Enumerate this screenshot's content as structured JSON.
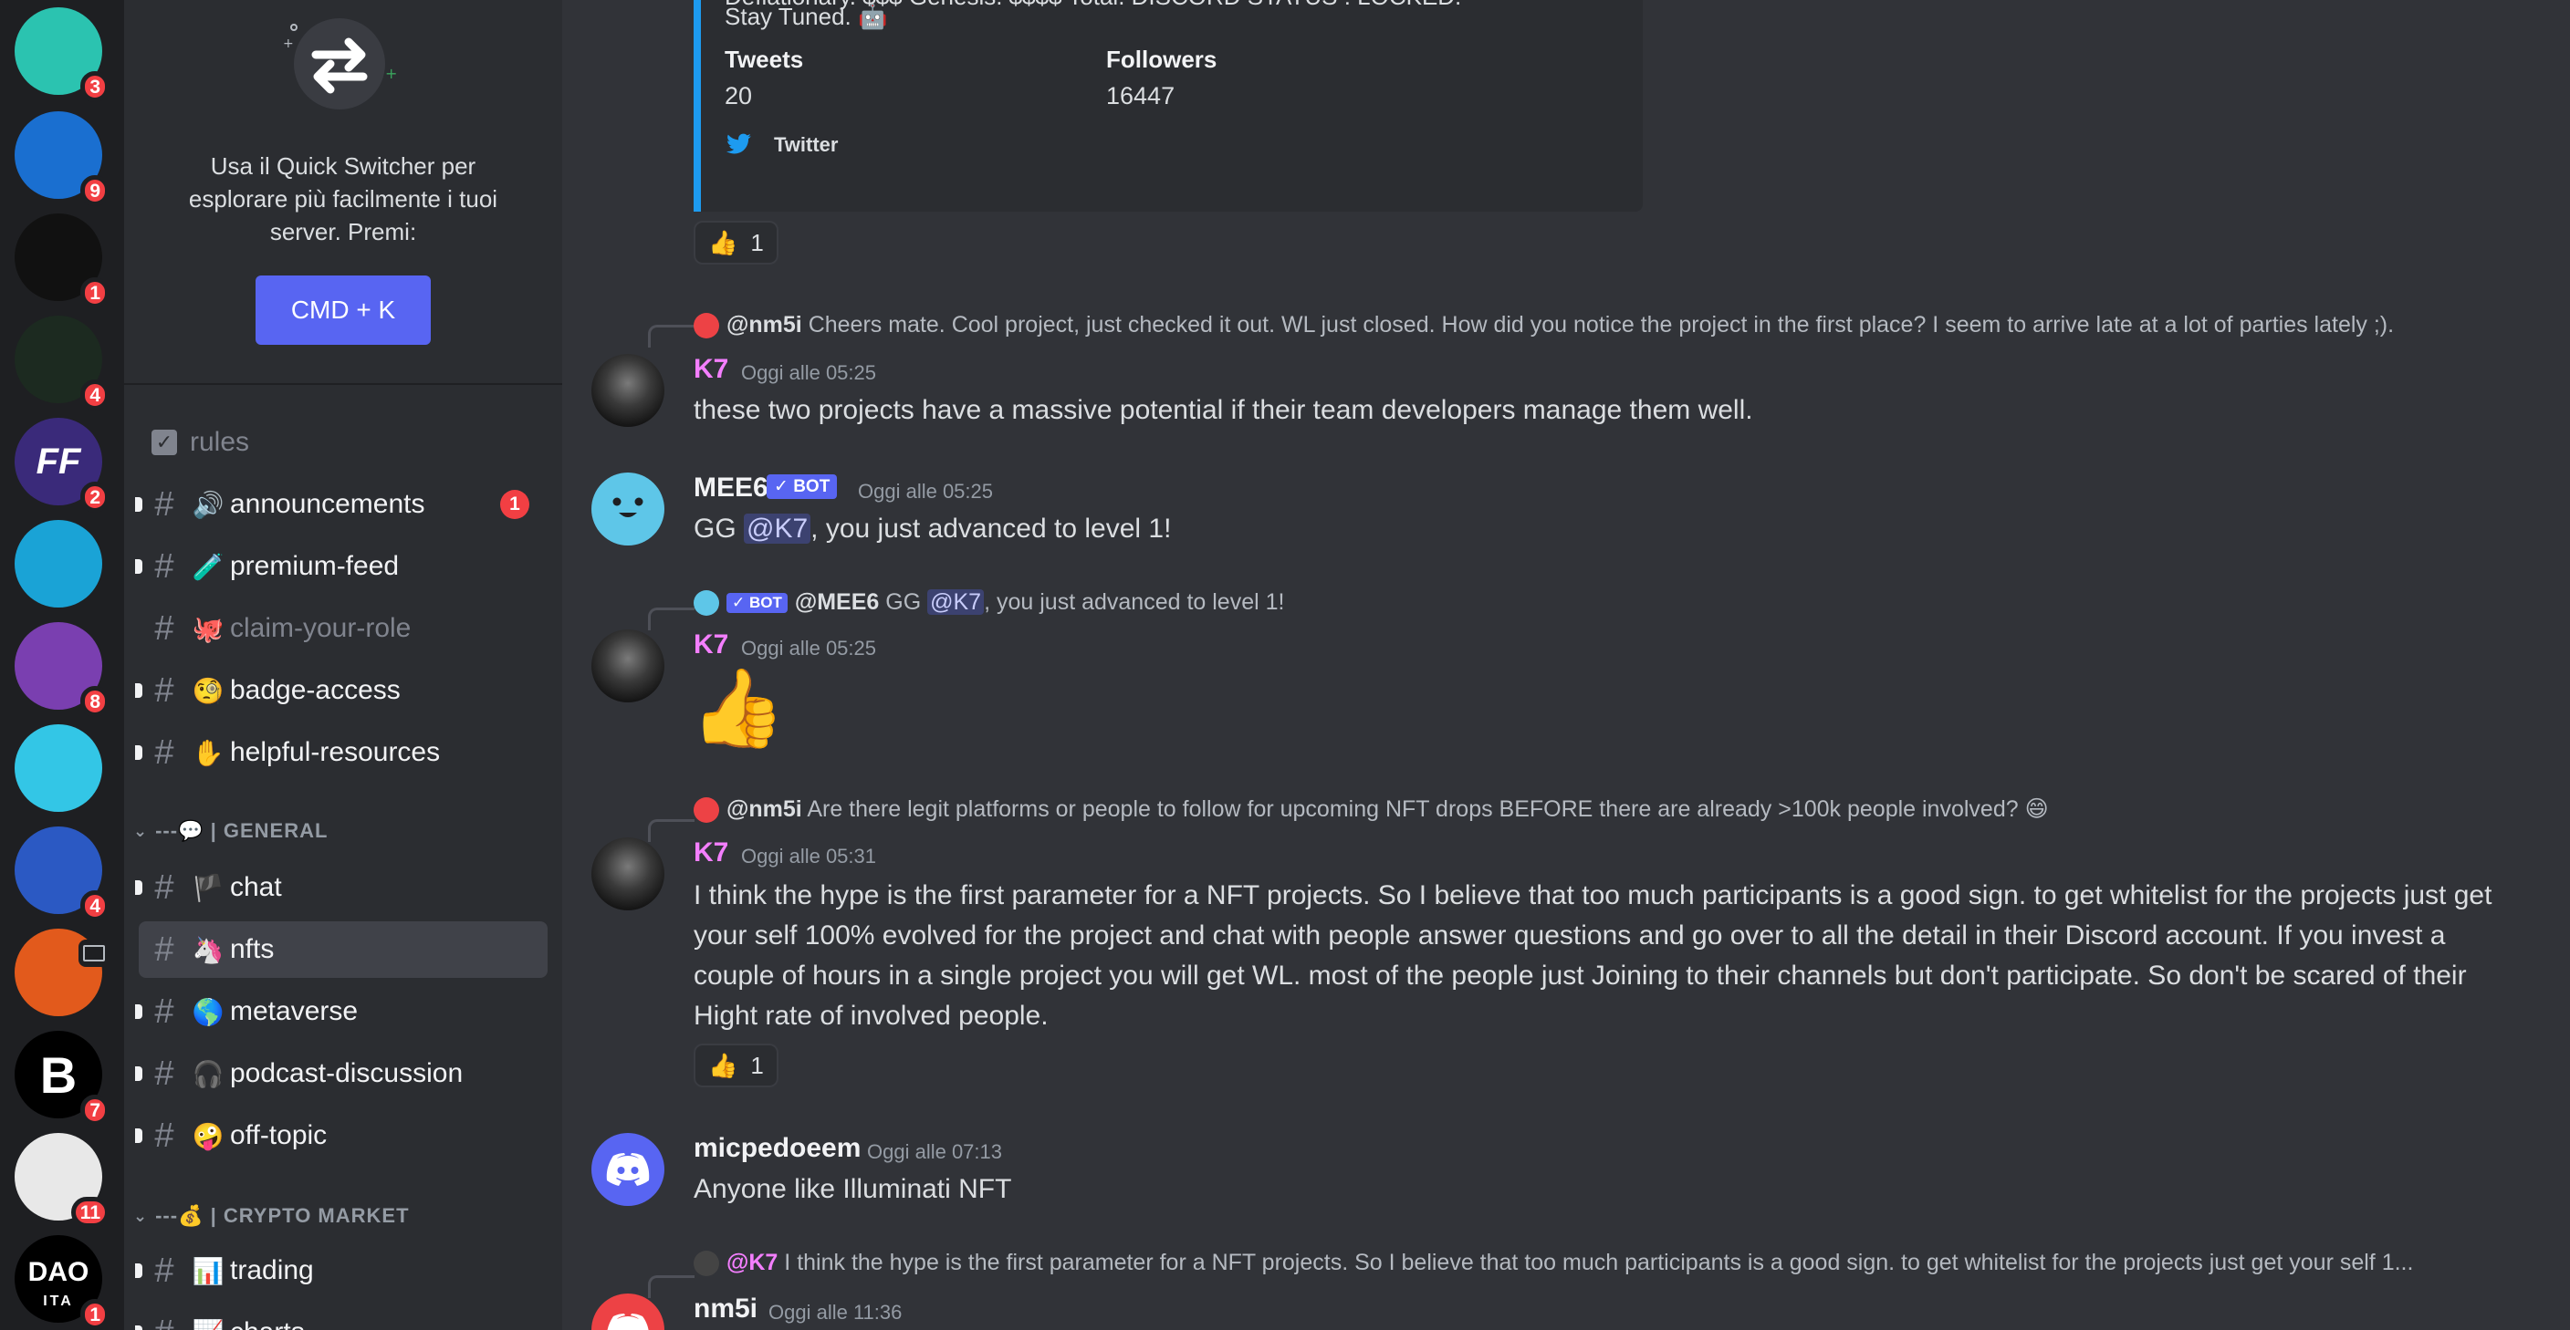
{
  "servers": [
    {
      "name": "alien-server",
      "badge": "3",
      "bg": "#2bc3b0"
    },
    {
      "name": "rocket-server",
      "badge": "9",
      "bg": "#1a6fd0"
    },
    {
      "name": "hourglass-server",
      "badge": "1",
      "bg": "#111111"
    },
    {
      "name": "green-shape-server",
      "badge": "4",
      "bg": "#1c2a20"
    },
    {
      "name": "ff-server",
      "label": "FF",
      "badge": "2",
      "bg": "#3a2a7a"
    },
    {
      "name": "swirl-server",
      "badge": "",
      "bg": "#1aa3d6"
    },
    {
      "name": "hat-server",
      "badge": "8",
      "bg": "#7a3fb0"
    },
    {
      "name": "wave-server",
      "badge": "",
      "bg": "#33c6e6"
    },
    {
      "name": "blue-rocket-server",
      "badge": "4",
      "bg": "#2b59c3"
    },
    {
      "name": "pizza-server",
      "badge": "",
      "bg": "#e25a1c"
    },
    {
      "name": "b-server",
      "label": "B",
      "badge": "7",
      "bg": "#000000"
    },
    {
      "name": "avatar-server",
      "badge": "11",
      "bg": "#e8e8e8"
    },
    {
      "name": "dao-server",
      "label": "DAO",
      "sublabel": "ITA",
      "badge": "1",
      "bg": "#000000"
    }
  ],
  "switcher": {
    "text": "Usa il Quick Switcher per esplorare più facilmente i tuoi server. Premi:",
    "button": "CMD + K"
  },
  "channels": {
    "rules": "rules",
    "announcements": {
      "name": "announcements",
      "emoji": "🔊",
      "unread": "1"
    },
    "premium": {
      "name": "premium-feed",
      "emoji": "🧪"
    },
    "claim": {
      "name": "claim-your-role",
      "emoji": "🐙"
    },
    "badge": {
      "name": "badge-access",
      "emoji": "🧐"
    },
    "helpful": {
      "name": "helpful-resources",
      "emoji": "✋"
    },
    "general_category": "---💬 | GENERAL",
    "chat": {
      "name": "chat",
      "emoji": "🏴"
    },
    "nfts": {
      "name": "nfts",
      "emoji": "🦄"
    },
    "metaverse": {
      "name": "metaverse",
      "emoji": "🌎"
    },
    "podcast": {
      "name": "podcast-discussion",
      "emoji": "🎧"
    },
    "offtopic": {
      "name": "off-topic",
      "emoji": "🤪"
    },
    "crypto_category": "---💰 | CRYPTO MARKET",
    "trading": {
      "name": "trading",
      "emoji": "📊"
    },
    "charts": {
      "name": "charts",
      "emoji": "📈"
    }
  },
  "embed": {
    "line1": "Deflationary. $$$ Genesis. $$$$ Total. DISCORD STATUS : LOCKED.",
    "line2": "Stay Tuned. 🤖",
    "tweets_label": "Tweets",
    "tweets_value": "20",
    "followers_label": "Followers",
    "followers_value": "16447",
    "footer": "Twitter"
  },
  "reaction1": {
    "emoji": "👍",
    "count": "1"
  },
  "messages": {
    "m1": {
      "reply_name": "@nm5i",
      "reply_text": "Cheers mate. Cool project, just checked it out. WL just closed. How did you notice the project in the first place? I seem to arrive late at a lot of parties lately ;).",
      "author": "K7",
      "author_color": "#f47fff",
      "time": "Oggi alle 05:25",
      "text": "these two projects have a massive potential if their team developers manage them well."
    },
    "m2": {
      "author": "MEE6",
      "bot": "✓ BOT",
      "time": "Oggi alle 05:25",
      "text_pre": "GG ",
      "mention": "@K7",
      "text_post": ", you just advanced to level 1!"
    },
    "m3": {
      "reply_bot": "✓ BOT",
      "reply_name": "@MEE6",
      "reply_pre": "GG ",
      "reply_mention": "@K7",
      "reply_post": ", you just advanced to level 1!",
      "author": "K7",
      "time": "Oggi alle 05:25",
      "big_emoji": "👍"
    },
    "m4": {
      "reply_name": "@nm5i",
      "reply_text": "Are there legit platforms or people to follow for upcoming NFT drops BEFORE there are already >100k people involved? 😄",
      "author": "K7",
      "time": "Oggi alle 05:31",
      "lines": [
        "I think the hype is the first parameter for a NFT projects. So I believe that too much participants is a good sign. to get whitelist for the projects just get",
        "your self 100% evolved for the project and chat with people answer questions and go over to all the detail in their Discord account. If you invest a",
        "couple of hours in a single project you will get WL. most of the people just Joining to their channels but don't participate. So don't be scared of their",
        "Hight rate of involved people."
      ],
      "reaction_emoji": "👍",
      "reaction_count": "1"
    },
    "m5": {
      "author": "micpedoeem",
      "time": "Oggi alle 07:13",
      "text": "Anyone like Illuminati NFT"
    },
    "m6": {
      "reply_name": "@K7",
      "reply_text": "I think the hype is the first parameter for a NFT projects. So I believe that too much participants is a good sign. to get whitelist for the projects just get your self 1...",
      "author": "nm5i",
      "time": "Oggi alle 11:36"
    }
  }
}
